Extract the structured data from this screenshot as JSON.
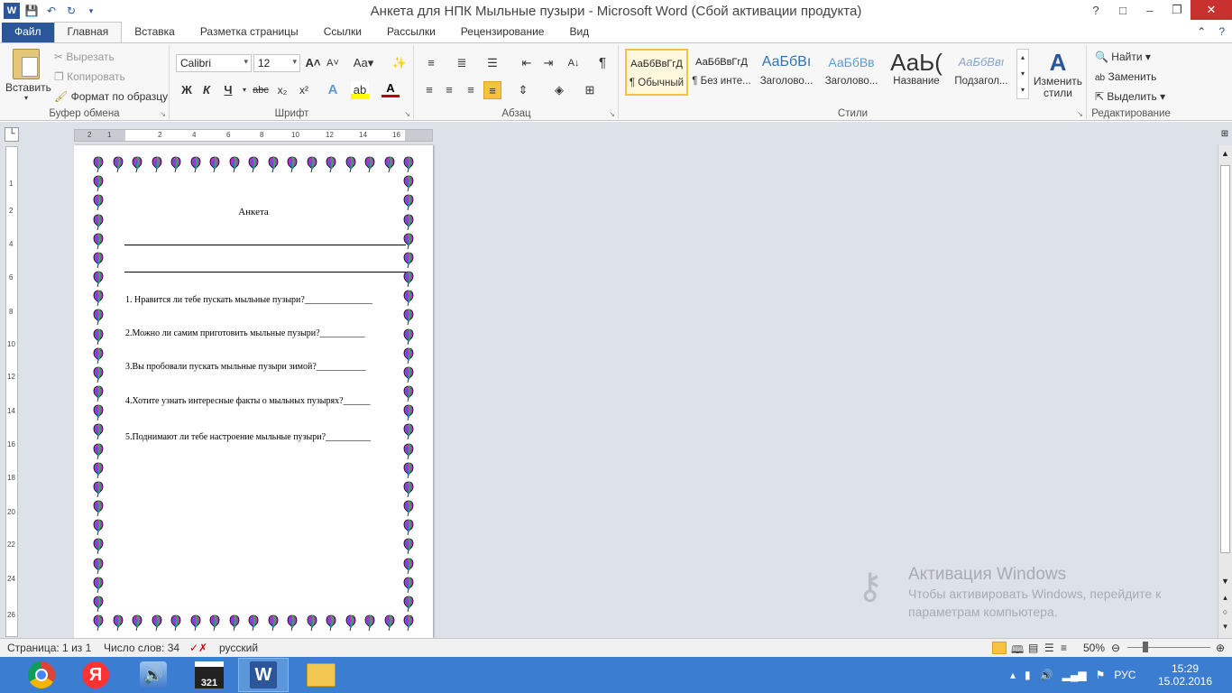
{
  "window": {
    "title": "Анкета для НПК Мыльные пузыри  -  Microsoft Word (Сбой активации продукта)"
  },
  "tabs": [
    "Файл",
    "Главная",
    "Вставка",
    "Разметка страницы",
    "Ссылки",
    "Рассылки",
    "Рецензирование",
    "Вид"
  ],
  "ribbon": {
    "clipboard": {
      "paste": "Вставить",
      "cut": "Вырезать",
      "copy": "Копировать",
      "format_painter": "Формат по образцу",
      "label": "Буфер обмена"
    },
    "font": {
      "name": "Calibri",
      "size": "12",
      "label": "Шрифт",
      "bold": "Ж",
      "italic": "К",
      "underline": "Ч",
      "strike": "abc",
      "change_case": "Aa"
    },
    "paragraph": {
      "label": "Абзац"
    },
    "styles": {
      "label": "Стили",
      "items": [
        {
          "sample": "АаБбВвГгД",
          "name": "¶ Обычный"
        },
        {
          "sample": "АаБбВвГгД",
          "name": "¶ Без инте..."
        },
        {
          "sample": "АаБбВı",
          "name": "Заголово..."
        },
        {
          "sample": "АаБбВв",
          "name": "Заголово..."
        },
        {
          "sample": "АаЬ(",
          "name": "Название"
        },
        {
          "sample": "АаБбВвı",
          "name": "Подзагол..."
        }
      ],
      "change_styles": "Изменить стили"
    },
    "editing": {
      "label": "Редактирование",
      "find": "Найти",
      "replace": "Заменить",
      "select": "Выделить"
    }
  },
  "ruler": {
    "h_numbers": [
      "2",
      "1",
      "2",
      "4",
      "6",
      "8",
      "10",
      "12",
      "14",
      "16"
    ],
    "v_numbers": [
      "1",
      "2",
      "4",
      "6",
      "8",
      "10",
      "12",
      "14",
      "16",
      "18",
      "20",
      "22",
      "24",
      "26"
    ]
  },
  "document": {
    "title": "Анкета",
    "questions": [
      "1. Нравится ли тебе пускать мыльные пузыри?_______________",
      "2.Можно ли самим   приготовить мыльные пузыри?__________",
      "3.Вы пробовали пускать мыльные пузыри зимой?___________",
      "4.Хотите узнать интересные факты о мыльных пузырях?______",
      "5.Поднимают ли тебе настроение мыльные пузыри?__________"
    ]
  },
  "watermark": {
    "title": "Активация Windows",
    "line1": "Чтобы активировать Windows, перейдите к",
    "line2": "параметрам компьютера."
  },
  "status": {
    "page": "Страница: 1 из 1",
    "words": "Число слов: 34",
    "language": "русский",
    "zoom": "50%"
  },
  "taskbar": {
    "lang": "РУС",
    "time": "15:29",
    "date": "15.02.2016"
  },
  "colors": {
    "word_blue": "#2b579a",
    "taskbar": "#3b7ed1",
    "close_red": "#c7302d"
  }
}
